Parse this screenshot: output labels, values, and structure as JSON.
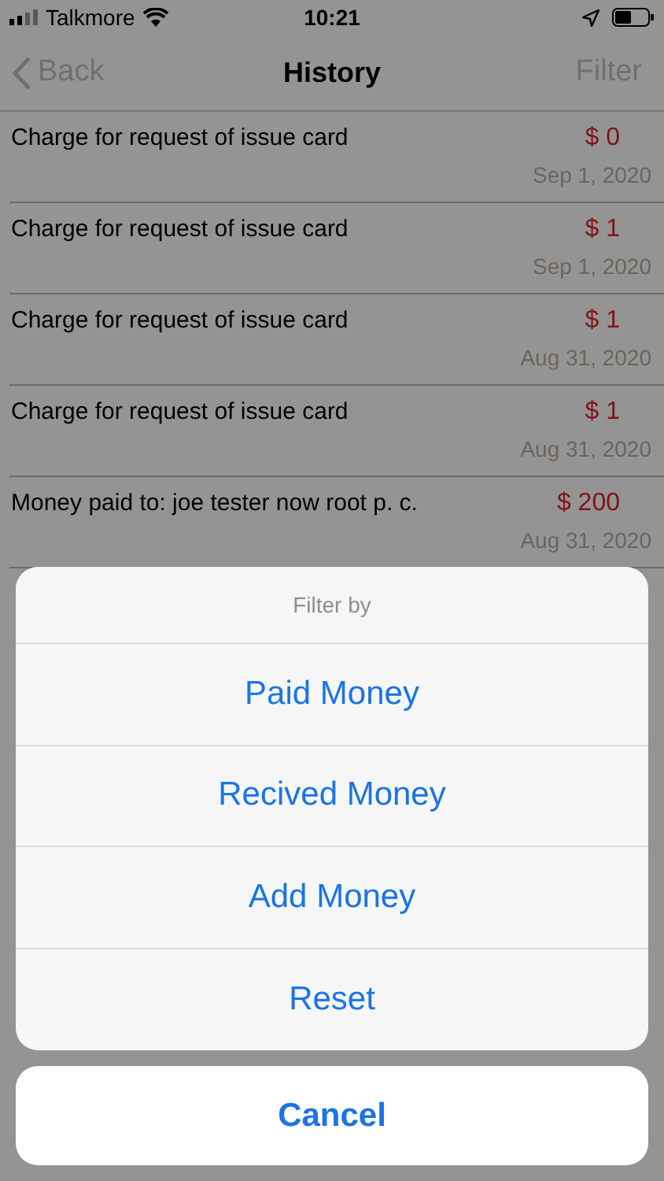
{
  "status_bar": {
    "carrier": "Talkmore",
    "time": "10:21"
  },
  "nav": {
    "back": "Back",
    "title": "History",
    "action": "Filter"
  },
  "transactions": [
    {
      "title": "Charge for request of issue card",
      "amount": "$ 0",
      "date": "Sep 1, 2020"
    },
    {
      "title": "Charge for request of issue card",
      "amount": "$ 1",
      "date": "Sep 1, 2020"
    },
    {
      "title": "Charge for request of issue card",
      "amount": "$ 1",
      "date": "Aug 31, 2020"
    },
    {
      "title": "Charge for request of issue card",
      "amount": "$ 1",
      "date": "Aug 31, 2020"
    },
    {
      "title": "Money paid to: joe tester now root p. c.",
      "amount": "$ 200",
      "date": "Aug 31, 2020"
    }
  ],
  "action_sheet": {
    "title": "Filter by",
    "options": [
      "Paid Money",
      "Recived Money",
      "Add Money",
      "Reset"
    ],
    "cancel": "Cancel"
  }
}
